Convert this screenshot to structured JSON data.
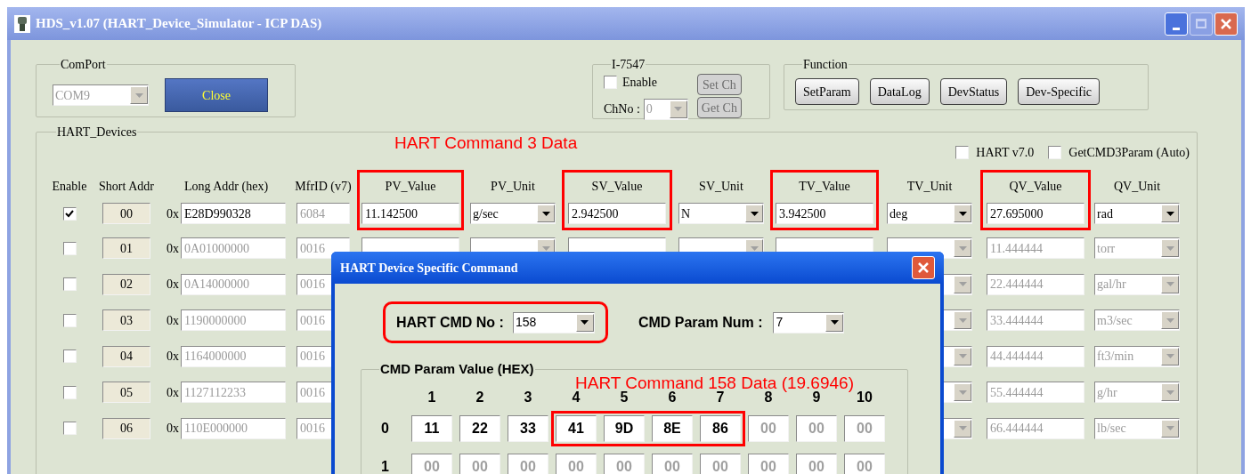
{
  "window": {
    "title": "HDS_v1.07 (HART_Device_Simulator - ICP DAS)"
  },
  "comport": {
    "label": "ComPort",
    "port": "COM9",
    "port_disabled": true,
    "button": "Close"
  },
  "i7547": {
    "label": "I-7547",
    "enable_label": "Enable",
    "enabled": false,
    "chno_label": "ChNo :",
    "chno": "0",
    "buttons": [
      {
        "label": "Set Ch",
        "disabled": true
      },
      {
        "label": "Get Ch",
        "disabled": true
      }
    ]
  },
  "function": {
    "label": "Function",
    "buttons": [
      "SetParam",
      "DataLog",
      "DevStatus",
      "Dev-Specific"
    ]
  },
  "devices": {
    "label": "HART_Devices",
    "annotation": "HART Command 3 Data",
    "options": [
      {
        "label": "HART v7.0",
        "checked": false
      },
      {
        "label": "GetCMD3Param (Auto)",
        "checked": false
      }
    ],
    "columns": [
      {
        "header": "Enable",
        "kind": "checkbox",
        "highlighted": false
      },
      {
        "header": "Short Addr",
        "kind": "label",
        "highlighted": false
      },
      {
        "header": "Long Addr (hex)",
        "kind": "hex",
        "highlighted": false
      },
      {
        "header": "MfrID (v7)",
        "kind": "text",
        "editable": false,
        "highlighted": false
      },
      {
        "header": "PV_Value",
        "kind": "text",
        "editable": true,
        "highlighted": true
      },
      {
        "header": "PV_Unit",
        "kind": "select",
        "highlighted": false
      },
      {
        "header": "SV_Value",
        "kind": "text",
        "editable": true,
        "highlighted": true
      },
      {
        "header": "SV_Unit",
        "kind": "select",
        "highlighted": false
      },
      {
        "header": "TV_Value",
        "kind": "text",
        "editable": true,
        "highlighted": true
      },
      {
        "header": "TV_Unit",
        "kind": "select",
        "highlighted": false
      },
      {
        "header": "QV_Value",
        "kind": "text",
        "editable": true,
        "highlighted": true
      },
      {
        "header": "QV_Unit",
        "kind": "select",
        "highlighted": false
      }
    ],
    "rows": [
      {
        "enabled": true,
        "short": "00",
        "prefix": "0x",
        "long": "E28D990328",
        "mfr": "6084",
        "pv": "11.142500",
        "pv_unit": "g/sec",
        "sv": "2.942500",
        "sv_unit": "N",
        "tv": "3.942500",
        "tv_unit": "deg",
        "qv": "27.695000",
        "qv_unit": "rad"
      },
      {
        "enabled": false,
        "short": "01",
        "prefix": "0x",
        "long": "0A01000000",
        "mfr": "0016",
        "qv": "11.444444",
        "qv_unit": "torr"
      },
      {
        "enabled": false,
        "short": "02",
        "prefix": "0x",
        "long": "0A14000000",
        "mfr": "0016",
        "qv": "22.444444",
        "qv_unit": "gal/hr"
      },
      {
        "enabled": false,
        "short": "03",
        "prefix": "0x",
        "long": "1190000000",
        "mfr": "0016",
        "qv": "33.444444",
        "qv_unit": "m3/sec"
      },
      {
        "enabled": false,
        "short": "04",
        "prefix": "0x",
        "long": "1164000000",
        "mfr": "0016",
        "qv": "44.444444",
        "qv_unit": "ft3/min"
      },
      {
        "enabled": false,
        "short": "05",
        "prefix": "0x",
        "long": "1127112233",
        "mfr": "0016",
        "qv": "55.444444",
        "qv_unit": "g/hr"
      },
      {
        "enabled": false,
        "short": "06",
        "prefix": "0x",
        "long": "110E000000",
        "mfr": "0016",
        "qv": "66.444444",
        "qv_unit": "lb/sec"
      }
    ]
  },
  "dialog": {
    "title": "HART Device Specific Command",
    "cmd_label": "HART CMD No :",
    "cmd": "158",
    "cmd_highlighted": true,
    "num_label": "CMD Param Num :",
    "num": "7",
    "group_label": "CMD Param Value (HEX)",
    "annotation": "HART Command 158 Data (19.6946)",
    "column_headers": [
      "1",
      "2",
      "3",
      "4",
      "5",
      "6",
      "7",
      "8",
      "9",
      "10"
    ],
    "rows": [
      {
        "label": "0",
        "groups": [
          {
            "highlighted": false,
            "cells": [
              {
                "value": "11",
                "enabled": true
              },
              {
                "value": "22",
                "enabled": true
              },
              {
                "value": "33",
                "enabled": true
              }
            ]
          },
          {
            "highlighted": true,
            "cells": [
              {
                "value": "41",
                "enabled": true
              },
              {
                "value": "9D",
                "enabled": true
              },
              {
                "value": "8E",
                "enabled": true
              },
              {
                "value": "86",
                "enabled": true
              }
            ]
          },
          {
            "highlighted": false,
            "cells": [
              {
                "value": "00",
                "enabled": false
              },
              {
                "value": "00",
                "enabled": false
              },
              {
                "value": "00",
                "enabled": false
              }
            ]
          }
        ]
      },
      {
        "label": "1",
        "groups": [
          {
            "highlighted": false,
            "cells": [
              {
                "value": "00",
                "enabled": false
              },
              {
                "value": "00",
                "enabled": false
              },
              {
                "value": "00",
                "enabled": false
              },
              {
                "value": "00",
                "enabled": false
              },
              {
                "value": "00",
                "enabled": false
              },
              {
                "value": "00",
                "enabled": false
              },
              {
                "value": "00",
                "enabled": false
              },
              {
                "value": "00",
                "enabled": false
              },
              {
                "value": "00",
                "enabled": false
              },
              {
                "value": "00",
                "enabled": false
              }
            ]
          }
        ]
      }
    ]
  }
}
